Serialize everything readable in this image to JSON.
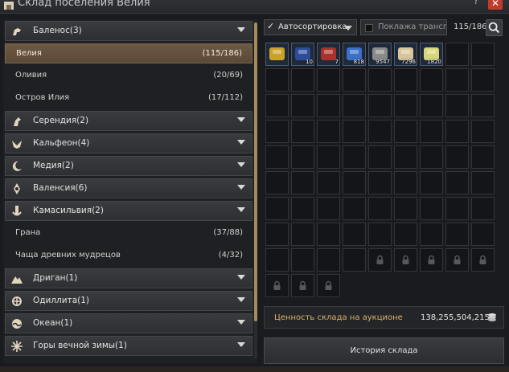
{
  "window": {
    "title": "Склад поселения Велия"
  },
  "regions": [
    {
      "label": "Баленос(3)",
      "icon": "horse-icon",
      "towns": [
        {
          "name": "Велия",
          "count": "(115/186)",
          "selected": true
        },
        {
          "name": "Оливия",
          "count": "(20/69)"
        },
        {
          "name": "Остров Илия",
          "count": "(17/112)"
        }
      ]
    },
    {
      "label": "Серендия(2)",
      "icon": "horse-head-icon",
      "towns": []
    },
    {
      "label": "Кальфеон(4)",
      "icon": "wings-icon",
      "towns": []
    },
    {
      "label": "Медия(2)",
      "icon": "moon-icon",
      "towns": []
    },
    {
      "label": "Валенсия(6)",
      "icon": "ornament-icon",
      "towns": []
    },
    {
      "label": "Камасильвия(2)",
      "icon": "anchor-icon",
      "towns": [
        {
          "name": "Грана",
          "count": "(37/88)"
        },
        {
          "name": "Чаща древних мудрецов",
          "count": "(4/32)"
        }
      ]
    },
    {
      "label": "Дриган(1)",
      "icon": "mountain-icon",
      "towns": []
    },
    {
      "label": "Одиллита(1)",
      "icon": "emblem-icon",
      "towns": []
    },
    {
      "label": "Океан(1)",
      "icon": "wave-icon",
      "towns": []
    },
    {
      "label": "Горы вечной зимы(1)",
      "icon": "snowflake-icon",
      "towns": []
    }
  ],
  "toolbar": {
    "autosort_label": "Автосортировка",
    "autosort_checked": true,
    "transport_label": "Поклажа трансп...",
    "transport_checked": false,
    "capacity": "115/186"
  },
  "inventory": {
    "columns": 9,
    "rows": 9,
    "items": [
      {
        "name": "gold-bar-icon",
        "qty": "",
        "color": "#c9a227"
      },
      {
        "name": "scroll-chest-icon",
        "qty": "10",
        "color": "#2d4c9a"
      },
      {
        "name": "red-box-icon",
        "qty": "7",
        "color": "#a8322c"
      },
      {
        "name": "potion-icon",
        "qty": "818",
        "color": "#3b6fc9"
      },
      {
        "name": "ore-icon",
        "qty": "9547",
        "color": "#8a8a8a"
      },
      {
        "name": "fan-icon",
        "qty": "7296",
        "color": "#d7c69a"
      },
      {
        "name": "gem-pile-icon",
        "qty": "1820",
        "color": "#d7d77a"
      }
    ],
    "locked_from": 76,
    "total_slots": 84
  },
  "auction": {
    "label": "Ценность склада на аукционе",
    "value": "138,255,504,215"
  },
  "history_button": "История склада"
}
